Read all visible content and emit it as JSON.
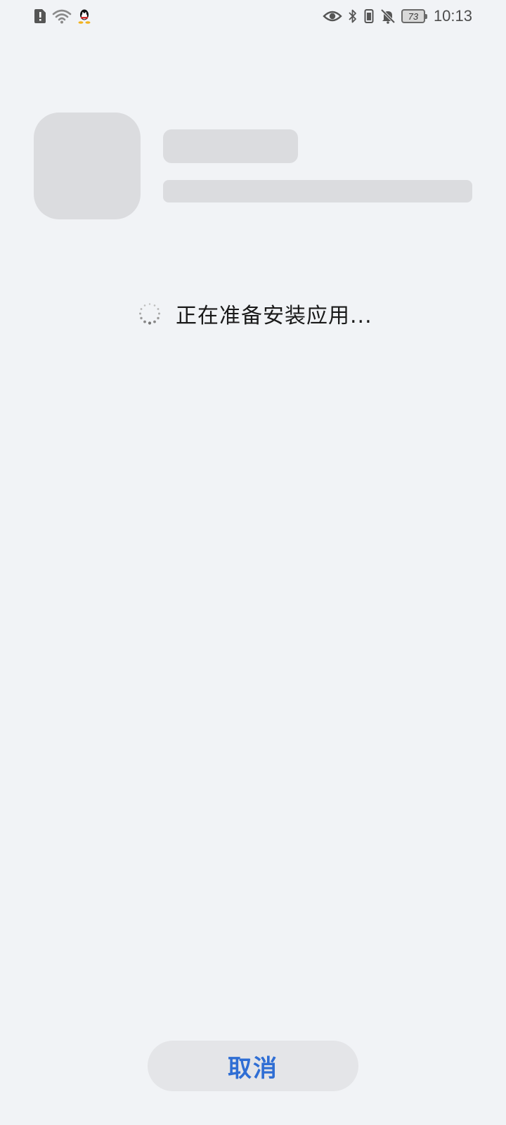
{
  "status_bar": {
    "time": "10:13",
    "battery_level": "73",
    "left_icons": [
      "sim-alert-icon",
      "wifi-icon",
      "qq-icon"
    ],
    "right_icons": [
      "eye-icon",
      "bluetooth-icon",
      "vibrate-icon",
      "bell-off-icon",
      "battery-icon"
    ]
  },
  "install": {
    "status_text": "正在准备安装应用..."
  },
  "actions": {
    "cancel_label": "取消"
  },
  "colors": {
    "background": "#f1f3f6",
    "placeholder": "#dbdcdf",
    "accent": "#2f6ed4",
    "button_bg": "#e4e5e8"
  }
}
